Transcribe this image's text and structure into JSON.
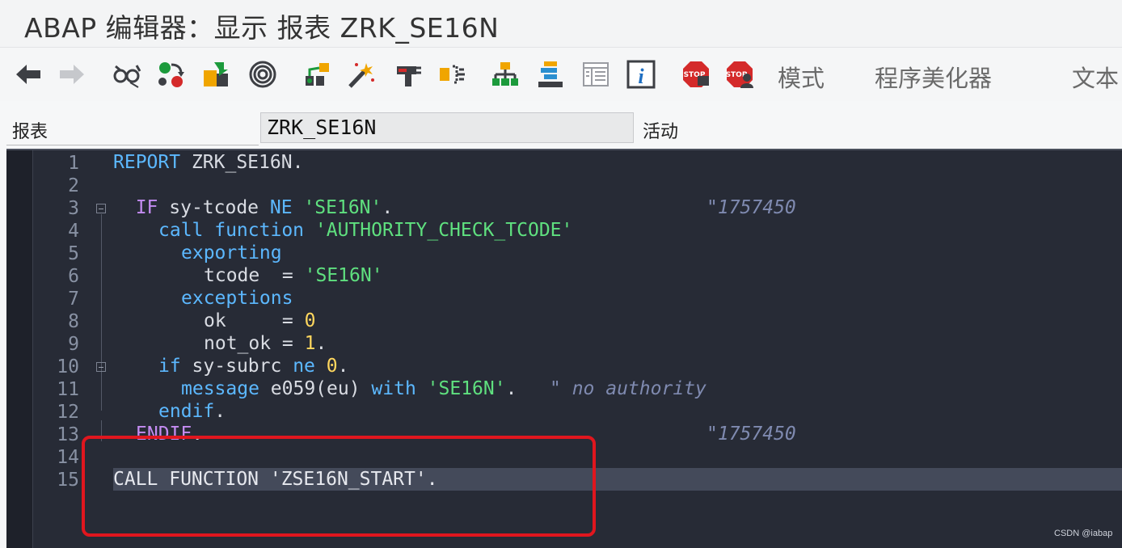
{
  "window": {
    "title": "ABAP 编辑器：显示 报表 ZRK_SE16N"
  },
  "toolbar": {
    "icons": [
      "back-arrow-icon",
      "forward-arrow-icon",
      "glasses-icon",
      "other-object-icon",
      "activate-icon",
      "where-used-icon",
      "object-list-icon",
      "magic-wand-icon",
      "display-object-icon",
      "enhancement-icon",
      "hierarchy-icon",
      "stack-icon",
      "layout-icon",
      "info-icon",
      "stop-icon",
      "stop-user-icon"
    ],
    "pattern_label": "模式",
    "pretty_printer_label": "程序美化器",
    "text_label": "文本"
  },
  "form": {
    "report_label": "报表",
    "report_value": "ZRK_SE16N",
    "status_text": "活动"
  },
  "editor": {
    "line_numbers": [
      "1",
      "2",
      "3",
      "4",
      "5",
      "6",
      "7",
      "8",
      "9",
      "10",
      "11",
      "12",
      "13",
      "14",
      "15"
    ],
    "current_line": 15
  },
  "code": {
    "l1_kw": "REPORT",
    "l1_rest": " ZRK_SE16N.",
    "l3_indent": "  ",
    "l3_if": "IF",
    "l3_var": " sy-tcode ",
    "l3_ne": "NE",
    "l3_str": " 'SE16N'",
    "l3_dot": ".",
    "l3_comment": "\"1757450",
    "l4_call": "call function",
    "l4_str": "'AUTHORITY_CHECK_TCODE'",
    "l5_exporting": "exporting",
    "l6_tcode": "tcode  = ",
    "l6_str": "'SE16N'",
    "l7_exceptions": "exceptions",
    "l8_ok": "ok     = ",
    "l8_num": "0",
    "l9_notok": "not_ok = ",
    "l9_num": "1",
    "l9_dot": ".",
    "l10_if": "if",
    "l10_var": " sy-subrc ",
    "l10_ne": "ne",
    "l10_num": " 0",
    "l10_dot": ".",
    "l11_message": "message",
    "l11_id": " e059(eu) ",
    "l11_with": "with",
    "l11_str": " 'SE16N'",
    "l11_dot": ".",
    "l11_comment": "\" no authority",
    "l12_endif": "endif",
    "l12_dot": ".",
    "l13_endif": "ENDIF",
    "l13_dot": ".",
    "l13_comment": "\"1757450",
    "l15_code": "CALL FUNCTION 'ZSE16N_START'."
  },
  "watermark": "CSDN @iabap",
  "colors": {
    "editor_bg": "#272b36",
    "keyword": "#5cb8ff",
    "string": "#5fe07f",
    "number": "#ffd75e",
    "highlight_box": "#e0161e"
  }
}
